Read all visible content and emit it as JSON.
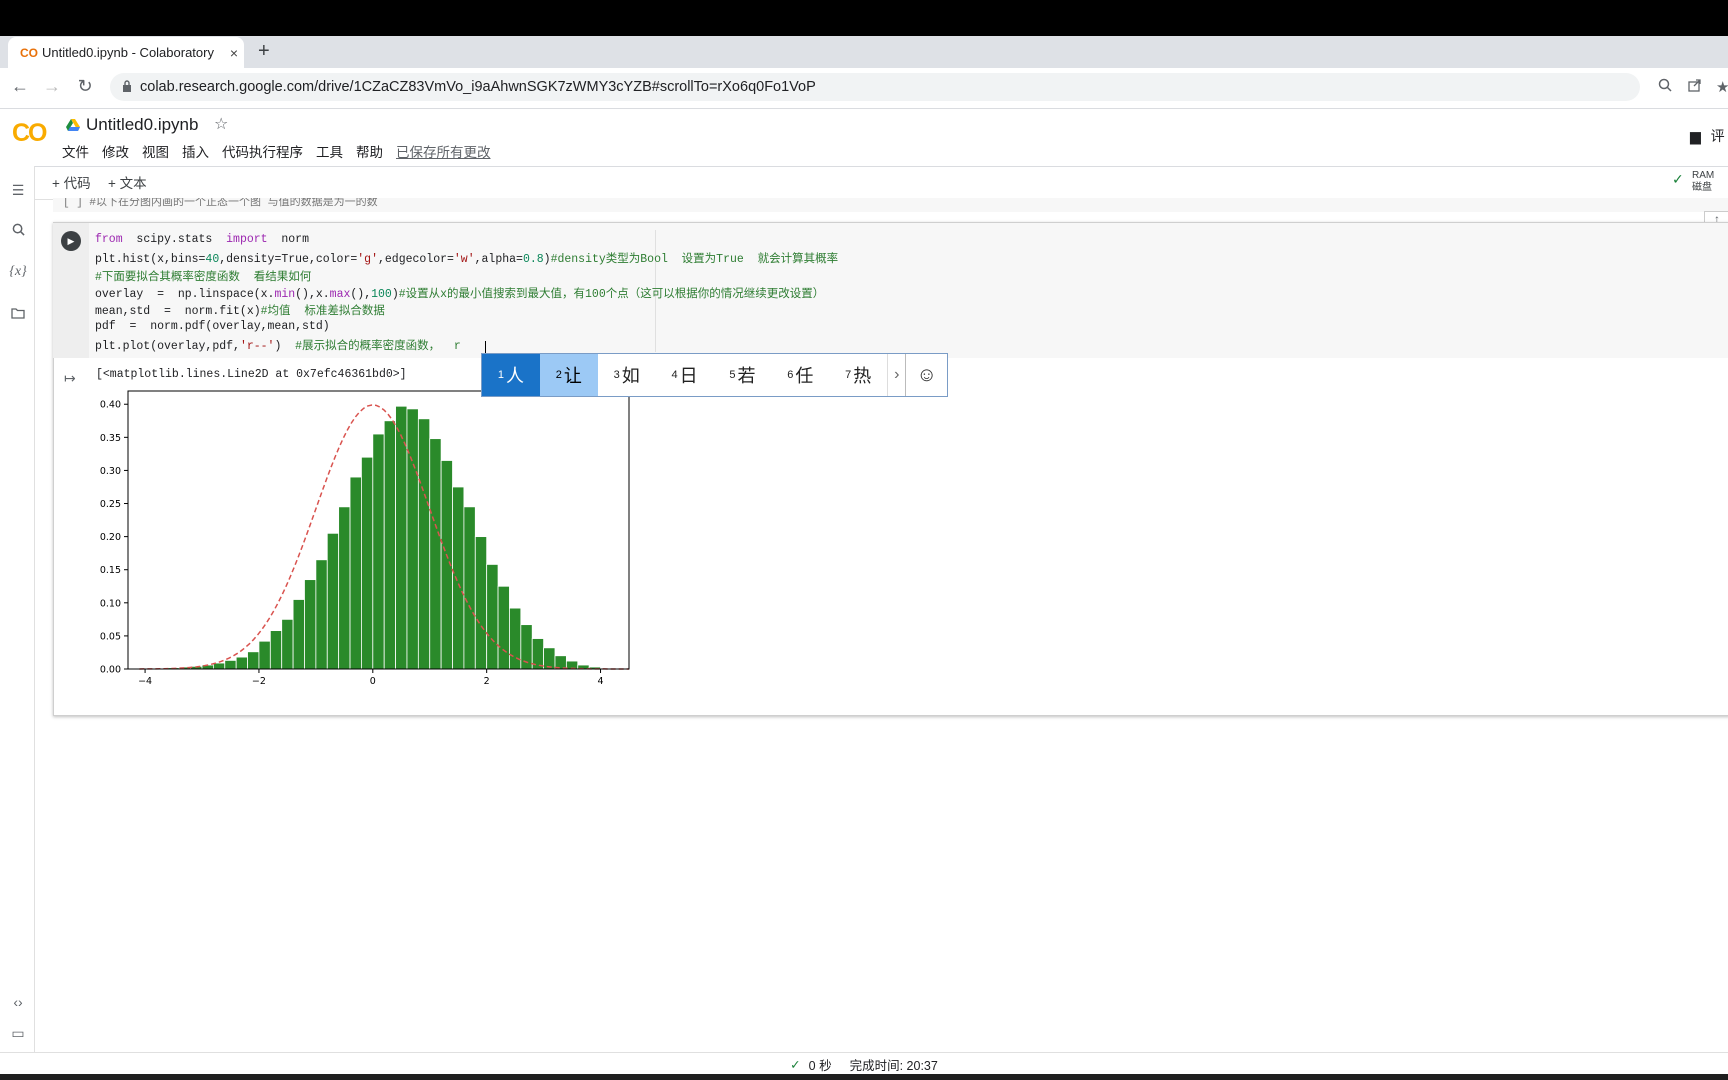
{
  "browser": {
    "tab_title": "Untitled0.ipynb - Colaboratory",
    "tab_favicon": "CO",
    "close_glyph": "×",
    "newtab_glyph": "+",
    "back_glyph": "←",
    "forward_glyph": "→",
    "reload_glyph": "↻",
    "url": "colab.research.google.com/drive/1CZaCZ83VmVo_i9aAhwnSGK7zWMY3cYZB#scrollTo=rXo6q0Fo1VoP"
  },
  "colab": {
    "logo": "CO",
    "notebook_title": "Untitled0.ipynb",
    "star_glyph": "☆",
    "menu": [
      "文件",
      "修改",
      "视图",
      "插入",
      "代码执行程序",
      "工具",
      "帮助"
    ],
    "saved_status": "已保存所有更改",
    "comment_label": "评",
    "toolbar": {
      "add_code": "+ 代码",
      "add_text": "+ 文本"
    },
    "resources": {
      "ram": "RAM",
      "disk": "磁盘"
    }
  },
  "prev_cell_text": "[ ] #以下在分图内画的一个正态一个图 与值的数据是为一的数",
  "code_lines": [
    [
      {
        "t": "from",
        "c": "kw"
      },
      {
        "t": "  scipy.stats  ",
        "c": ""
      },
      {
        "t": "import",
        "c": "kw"
      },
      {
        "t": "  norm",
        "c": ""
      }
    ],
    [
      {
        "t": "plt.hist(x,bins=",
        "c": ""
      },
      {
        "t": "40",
        "c": "num"
      },
      {
        "t": ",density=True,color=",
        "c": ""
      },
      {
        "t": "'g'",
        "c": "str"
      },
      {
        "t": ",edgecolor=",
        "c": ""
      },
      {
        "t": "'w'",
        "c": "str"
      },
      {
        "t": ",alpha=",
        "c": ""
      },
      {
        "t": "0.8",
        "c": "num"
      },
      {
        "t": ")",
        "c": ""
      },
      {
        "t": "#density类型为Bool  设置为True  就会计算其概率",
        "c": "cm"
      }
    ],
    [
      {
        "t": "#下面要拟合其概率密度函数  看结果如何",
        "c": "cm"
      }
    ],
    [
      {
        "t": "overlay  =  np.linspace(x.",
        "c": ""
      },
      {
        "t": "min",
        "c": "kw"
      },
      {
        "t": "(),x.",
        "c": ""
      },
      {
        "t": "max",
        "c": "kw"
      },
      {
        "t": "(),",
        "c": ""
      },
      {
        "t": "100",
        "c": "num"
      },
      {
        "t": ")",
        "c": ""
      },
      {
        "t": "#设置从x的最小值搜索到最大值，有100个点（这可以根据你的情况继续更改设置）",
        "c": "cm"
      }
    ],
    [
      {
        "t": "mean,std  =  norm.fit(x)",
        "c": ""
      },
      {
        "t": "#均值  标准差拟合数据",
        "c": "cm"
      }
    ],
    [
      {
        "t": "pdf  =  norm.pdf(overlay,mean,std)",
        "c": ""
      }
    ],
    [
      {
        "t": "plt.plot(overlay,pdf,",
        "c": ""
      },
      {
        "t": "'r--'",
        "c": "str"
      },
      {
        "t": ")  ",
        "c": ""
      },
      {
        "t": "#展示拟合的概率密度函数，  r",
        "c": "cm"
      }
    ]
  ],
  "output_text": "[<matplotlib.lines.Line2D at 0x7efc46361bd0>]",
  "ime": {
    "candidates": [
      {
        "num": "1",
        "char": "人"
      },
      {
        "num": "2",
        "char": "让"
      },
      {
        "num": "3",
        "char": "如"
      },
      {
        "num": "4",
        "char": "日"
      },
      {
        "num": "5",
        "char": "若"
      },
      {
        "num": "6",
        "char": "任"
      },
      {
        "num": "7",
        "char": "热"
      }
    ],
    "more_glyph": "›",
    "emoji_glyph": "☺"
  },
  "status": {
    "duration": "0 秒",
    "finished": "完成时间: 20:37"
  },
  "colors": {
    "bar": "#2a8a2a",
    "fit_line": "#d9534f",
    "ime_selected": "#1a73c8",
    "ime_hover": "#9cc9f5"
  },
  "chart_data": {
    "type": "bar",
    "title": "",
    "xlabel": "",
    "ylabel": "",
    "xlim": [
      -4.3,
      4.5
    ],
    "ylim": [
      0,
      0.42
    ],
    "x_ticks": [
      "−4",
      "−2",
      "0",
      "2",
      "4"
    ],
    "y_ticks": [
      "0.00",
      "0.05",
      "0.10",
      "0.15",
      "0.20",
      "0.25",
      "0.30",
      "0.35",
      "0.40"
    ],
    "bin_edges_start": -4.2,
    "bin_width": 0.2,
    "values": [
      0.001,
      0.001,
      0.001,
      0.002,
      0.003,
      0.004,
      0.006,
      0.009,
      0.013,
      0.018,
      0.026,
      0.042,
      0.058,
      0.075,
      0.105,
      0.135,
      0.165,
      0.205,
      0.245,
      0.29,
      0.32,
      0.355,
      0.375,
      0.397,
      0.393,
      0.378,
      0.348,
      0.315,
      0.275,
      0.245,
      0.2,
      0.158,
      0.125,
      0.092,
      0.067,
      0.046,
      0.032,
      0.02,
      0.012,
      0.006,
      0.003
    ],
    "series": [
      {
        "type": "bar",
        "values_ref": "values"
      },
      {
        "type": "line",
        "style": "dashed",
        "dist": "normal",
        "mean": 0.0,
        "std": 1.0
      }
    ]
  }
}
